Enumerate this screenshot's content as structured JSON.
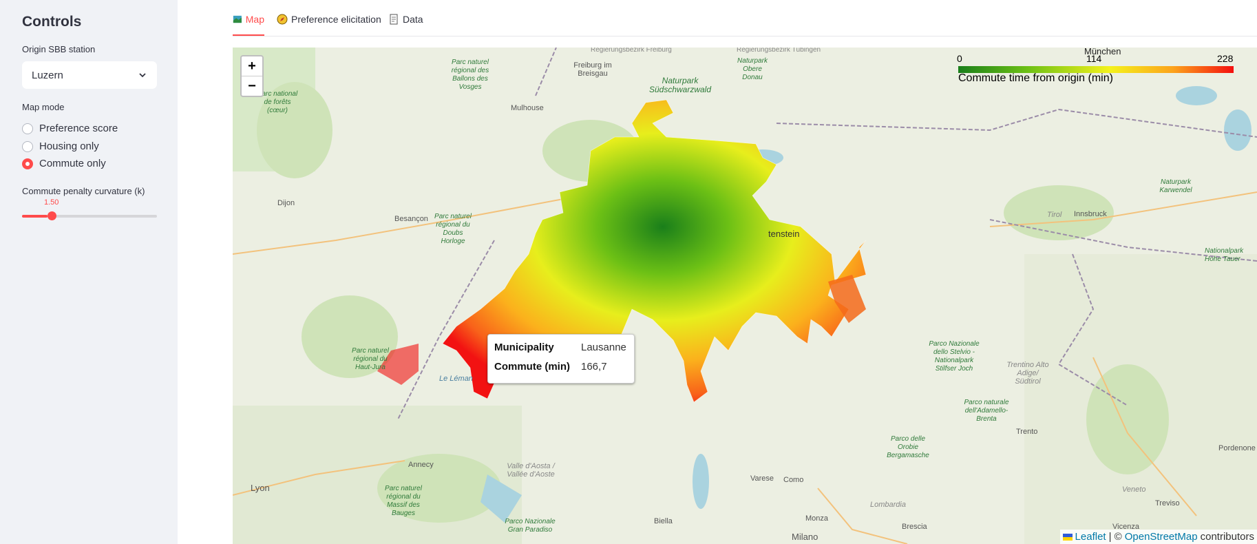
{
  "sidebar": {
    "title": "Controls",
    "station_label": "Origin SBB station",
    "station_value": "Luzern",
    "map_mode_label": "Map mode",
    "map_mode_options": [
      "Preference score",
      "Housing only",
      "Commute only"
    ],
    "map_mode_selected": "Commute only",
    "curvature_label": "Commute penalty curvature (k)",
    "curvature_value": "1.50",
    "curvature_fraction": 0.19
  },
  "tabs": [
    {
      "label": "Map",
      "icon": "map-icon",
      "active": true
    },
    {
      "label": "Preference elicitation",
      "icon": "compass-icon",
      "active": false
    },
    {
      "label": "Data",
      "icon": "page-icon",
      "active": false
    }
  ],
  "map": {
    "zoom_in": "+",
    "zoom_out": "−",
    "legend": {
      "ticks": [
        "0",
        "114",
        "228"
      ],
      "caption": "Commute time from origin (min)",
      "colors": [
        "#1a7f1a",
        "#6cc015",
        "#f4f21c",
        "#fca31c",
        "#f40f0f"
      ]
    },
    "tooltip": {
      "municipality_label": "Municipality",
      "municipality_value": "Lausanne",
      "commute_label": "Commute (min)",
      "commute_value": "166,7"
    },
    "attribution": {
      "leaflet": "Leaflet",
      "separator": "| ©",
      "osm": "OpenStreetMap",
      "suffix": "contributors"
    },
    "places": {
      "mulhouse": "Mulhouse",
      "freiburg": "Freiburg im Breisgau",
      "regbez_freiburg": "Regierungsbezirk Freiburg",
      "regbez_tuebingen": "Regierungsbezirk Tübingen",
      "muenchen": "München",
      "dijon": "Dijon",
      "besancon": "Besançon",
      "liechtenstein": "tenstein",
      "tirol": "Tirol",
      "innsbruck": "Innsbruck",
      "annecy": "Annecy",
      "lyon": "Lyon",
      "varese": "Varese",
      "como": "Como",
      "monza": "Monza",
      "milano": "Milano",
      "biella": "Biella",
      "brescia": "Brescia",
      "trento": "Trento",
      "treviso": "Treviso",
      "vicenza": "Vicenza",
      "veneto": "Veneto",
      "lombardia": "Lombardia",
      "pordenone": "Pordenone",
      "le_leman": "Le Léman",
      "trentino": "Trentino Alto Adige/ Südtirol",
      "valle_aosta": "Valle d'Aosta / Vallée d'Aoste"
    },
    "parks": {
      "ballons": "Parc naturel régional des Ballons des Vosges",
      "schwarzwald": "Naturpark Südschwarzwald",
      "obere_donau": "Naturpark Obere Donau",
      "doubs": "Parc naturel régional du Doubs Horloge",
      "haut_jura": "Parc naturel régional du Haut-Jura",
      "karwendel": "Naturpark Karwendel",
      "stelvio": "Parco Nazionale dello Stelvio - Nationalpark Stilfser Joch",
      "adamello": "Parco naturale dell'Adamello-Brenta",
      "orobie": "Parco delle Orobie Bergamasche",
      "bauges": "Parc naturel régional du Massif des Bauges",
      "gran_paradiso": "Parco Nazionale Gran Paradiso",
      "forets": "Parc national de forêts (cœur)",
      "hohe_tauern": "Nationalpark Hohe Tauer"
    }
  }
}
